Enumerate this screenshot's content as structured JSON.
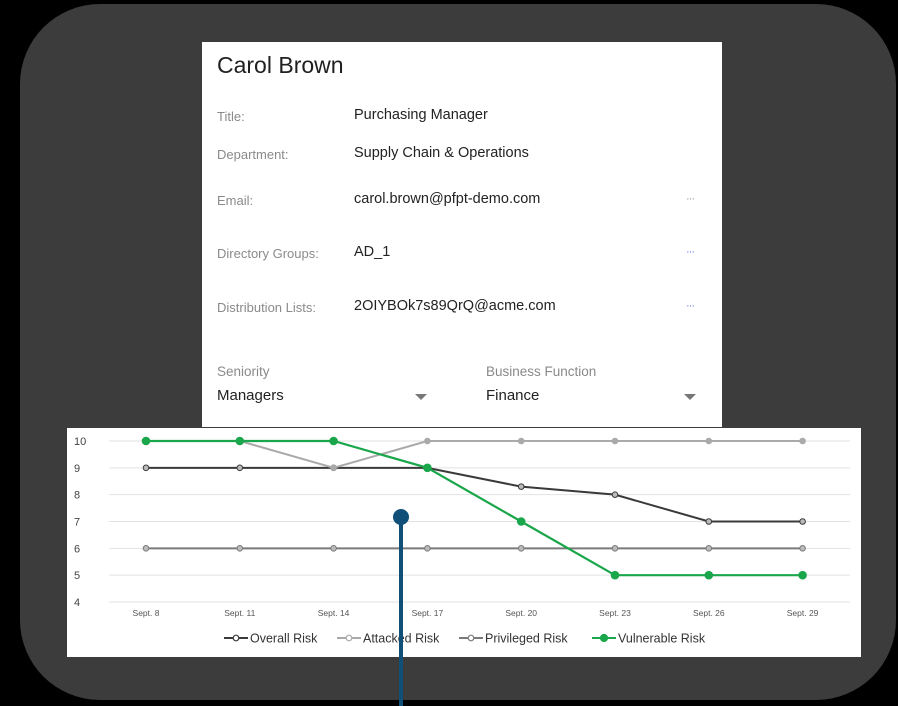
{
  "profile": {
    "name": "Carol Brown",
    "fields": [
      {
        "label": "Title:",
        "value": "Purchasing Manager"
      },
      {
        "label": "Department:",
        "value": "Supply Chain & Operations"
      },
      {
        "label": "Email:",
        "value": "carol.brown@pfpt-demo.com",
        "menu": "···"
      },
      {
        "label": "Directory Groups:",
        "value": "AD_1",
        "menu": "···"
      },
      {
        "label": "Distribution Lists:",
        "value": "2OIYBOk7s89QrQ@acme.com",
        "menu": "···"
      }
    ],
    "seniority": {
      "label": "Seniority",
      "value": "Managers"
    },
    "business_function": {
      "label": "Business Function",
      "value": "Finance"
    }
  },
  "chart_data": {
    "type": "line",
    "categories": [
      "Sept. 8",
      "Sept. 11",
      "Sept. 14",
      "Sept. 17",
      "Sept. 20",
      "Sept. 23",
      "Sept. 26",
      "Sept. 29"
    ],
    "ylim": [
      4,
      10
    ],
    "yticks": [
      4,
      5,
      6,
      7,
      8,
      9,
      10
    ],
    "grid": true,
    "legend": "bottom",
    "series": [
      {
        "name": "Overall Risk",
        "color": "#3a3a3a",
        "values": [
          9,
          9,
          9,
          9,
          8.3,
          8,
          7,
          7
        ]
      },
      {
        "name": "Attacked Risk",
        "color": "#aaaaaa",
        "values": [
          10,
          10,
          9,
          10,
          10,
          10,
          10,
          10
        ]
      },
      {
        "name": "Privileged Risk",
        "color": "#7a7a7a",
        "values": [
          6,
          6,
          6,
          6,
          6,
          6,
          6,
          6
        ]
      },
      {
        "name": "Vulnerable Risk",
        "color": "#1aa64a",
        "values": [
          10,
          10,
          10,
          9,
          7,
          5,
          5,
          5
        ]
      }
    ]
  },
  "colors": {
    "background": "#000000",
    "frame": "#3c3c3c",
    "pointer": "#0f4f78",
    "menu_dots_active": "#6b7ee0"
  }
}
